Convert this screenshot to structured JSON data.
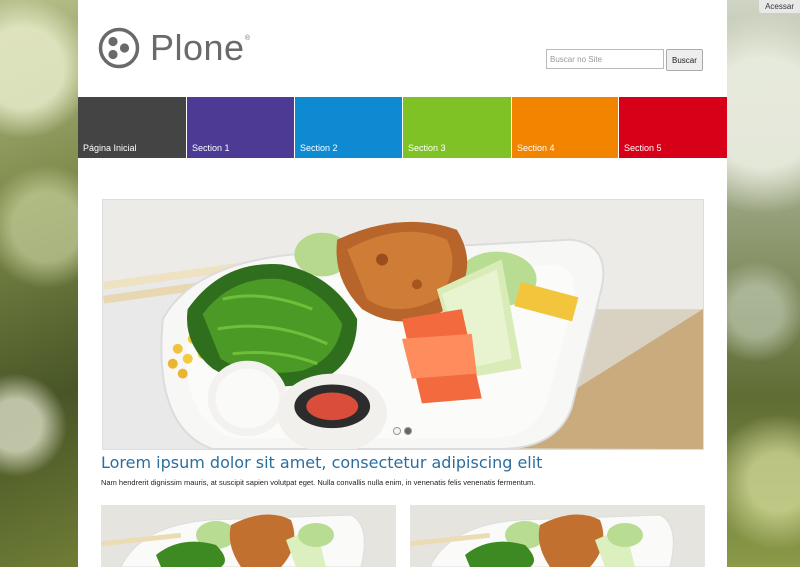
{
  "top_bar": {
    "access_label": "Acessar"
  },
  "site": {
    "logo_text": "Plone",
    "logo_mark": "®"
  },
  "search": {
    "placeholder": "Buscar no Site",
    "button_label": "Buscar"
  },
  "nav": {
    "items": [
      {
        "label": "Página Inicial",
        "color": "#444444"
      },
      {
        "label": "Section 1",
        "color": "#4d3a94"
      },
      {
        "label": "Section 2",
        "color": "#0e8ad3"
      },
      {
        "label": "Section 3",
        "color": "#7fc225"
      },
      {
        "label": "Section 4",
        "color": "#f28400"
      },
      {
        "label": "Section 5",
        "color": "#d70018"
      }
    ]
  },
  "carousel": {
    "slide_count": 2,
    "active_slide": 2
  },
  "article": {
    "title": "Lorem ipsum dolor sit amet, consectetur adipiscing elit",
    "summary": "Nam hendrerit dignissim mauris, at suscipit sapien volutpat eget. Nulla convallis nulla enim, in venenatis felis venenatis fermentum."
  }
}
